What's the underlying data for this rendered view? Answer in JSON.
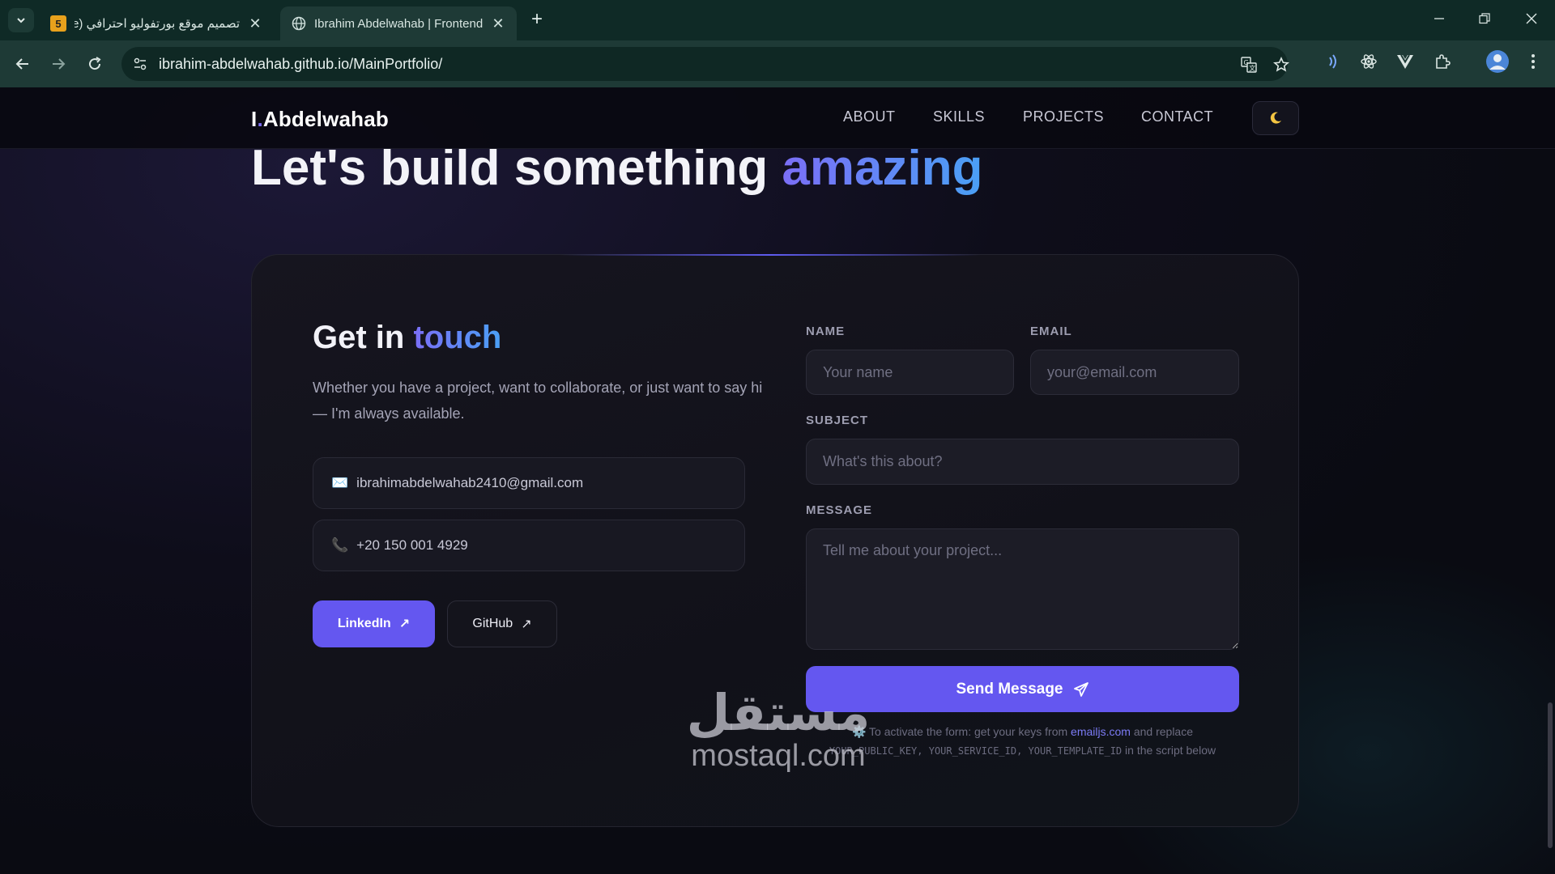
{
  "browser": {
    "tabs": [
      {
        "favicon_text": "5",
        "title": "تصميم موقع بورتفوليو احترافي (e",
        "active": false
      },
      {
        "title": "Ibrahim Abdelwahab | Frontend",
        "active": true
      }
    ],
    "url": "ibrahim-abdelwahab.github.io/MainPortfolio/"
  },
  "site": {
    "logo_initial": "I",
    "logo_dot": ".",
    "logo_name": "Abdelwahab",
    "nav": [
      "ABOUT",
      "SKILLS",
      "PROJECTS",
      "CONTACT"
    ],
    "theme_icon": "moon-icon"
  },
  "hero": {
    "prefix": "Let's build something ",
    "accent": "amazing"
  },
  "contact": {
    "title_prefix": "Get in ",
    "title_accent": "touch",
    "description": "Whether you have a project, want to collaborate, or just want to say hi — I'm always available.",
    "email_icon": "✉️",
    "email": "ibrahimabdelwahab2410@gmail.com",
    "phone_icon": "📞",
    "phone": "+20 150 001 4929",
    "linkedin_label": "LinkedIn",
    "github_label": "GitHub",
    "arrow": "↗"
  },
  "form": {
    "name_label": "NAME",
    "name_placeholder": "Your name",
    "email_label": "EMAIL",
    "email_placeholder": "your@email.com",
    "subject_label": "SUBJECT",
    "subject_placeholder": "What's this about?",
    "message_label": "MESSAGE",
    "message_placeholder": "Tell me about your project...",
    "send_label": "Send Message",
    "note_icon": "⚙️",
    "note_prefix": "To activate the form: get your keys from ",
    "note_link": "emailjs.com",
    "note_mid": " and replace",
    "note_keys": "YOUR_PUBLIC_KEY, YOUR_SERVICE_ID, YOUR_TEMPLATE_ID",
    "note_suffix": " in the script below"
  },
  "watermark": {
    "arabic": "مستقل",
    "latin": "mostaql.com"
  },
  "colors": {
    "accent": "#6457f0",
    "accent_gradient_end": "#4aa0f5",
    "browser_frame": "#1e3a36"
  }
}
